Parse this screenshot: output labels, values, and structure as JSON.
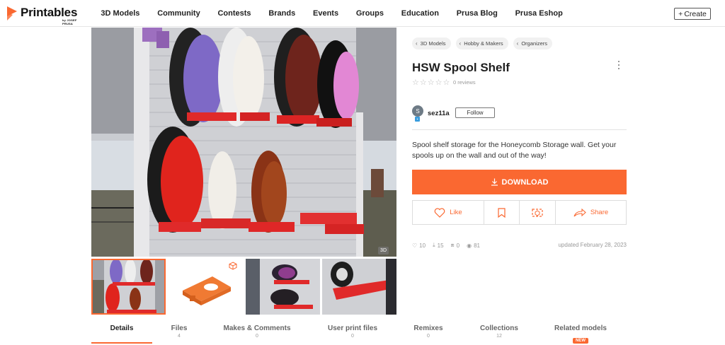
{
  "nav": {
    "logo_text": "Printables",
    "logo_sub": "by JOSEF PRUSA",
    "items": [
      "3D Models",
      "Community",
      "Contests",
      "Brands",
      "Events",
      "Groups",
      "Education",
      "Prusa Blog",
      "Prusa Eshop"
    ],
    "create_label": "Create",
    "brand_color": "#fa6831"
  },
  "gallery": {
    "badge_3d": "3D",
    "thumbnails": [
      "Photo of spool shelves with red spool",
      "3D model render (orange)",
      "Photo of shelves on honeycomb wall",
      "Photo of single shelf"
    ]
  },
  "breadcrumbs": [
    "3D Models",
    "Hobby & Makers",
    "Organizers"
  ],
  "model": {
    "title": "HSW Spool Shelf",
    "reviews": "0 reviews",
    "author": {
      "initial": "S",
      "name": "sez11a",
      "follow_label": "Follow"
    },
    "description": "Spool shelf storage for the Honeycomb Storage wall. Get your spools up on the wall and out of the way!",
    "download_label": "DOWNLOAD",
    "actions": {
      "like": "Like",
      "share": "Share"
    },
    "stats": {
      "likes": "10",
      "downloads": "15",
      "makes": "0",
      "views": "81"
    },
    "updated": "updated February 28, 2023"
  },
  "tabs": [
    {
      "label": "Details",
      "count": ""
    },
    {
      "label": "Files",
      "count": "4"
    },
    {
      "label": "Makes & Comments",
      "count": "0"
    },
    {
      "label": "User print files",
      "count": "0"
    },
    {
      "label": "Remixes",
      "count": "0"
    },
    {
      "label": "Collections",
      "count": "12"
    },
    {
      "label": "Related models",
      "count": "",
      "badge": "NEW"
    }
  ]
}
